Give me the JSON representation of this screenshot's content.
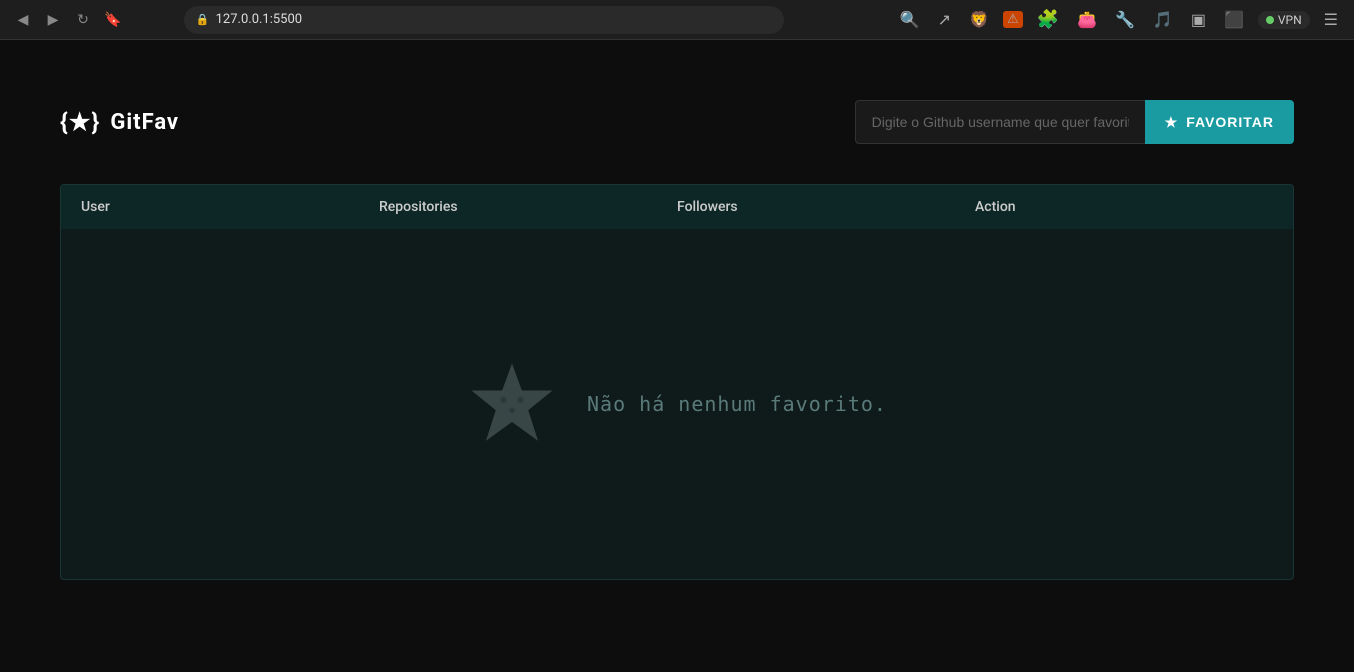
{
  "browser": {
    "url": "127.0.0.1:5500",
    "back_btn": "◀",
    "forward_btn": "▶",
    "reload_btn": "↻",
    "bookmark_icon": "🔖",
    "vpn_label": "VPN",
    "hamburger": "☰"
  },
  "header": {
    "logo_text": "{★} GitFav",
    "search_placeholder": "Digite o Github username que quer favoritar",
    "fav_button_label": "FAVORITAR",
    "star_icon": "★"
  },
  "table": {
    "columns": [
      "User",
      "Repositories",
      "Followers",
      "Action"
    ],
    "empty_text": "Não há nenhum favorito."
  }
}
